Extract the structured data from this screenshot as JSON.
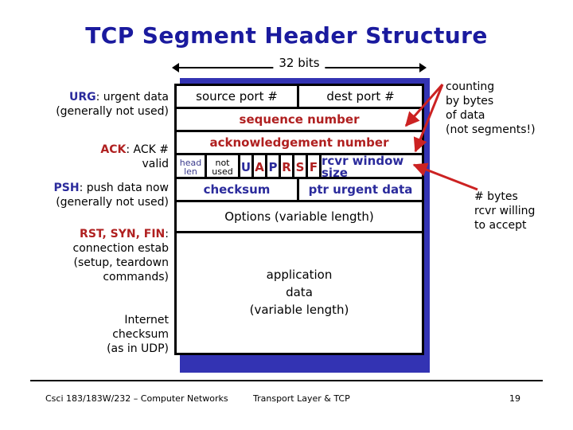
{
  "slide": {
    "title": "TCP Segment Header Structure",
    "page_number": "19"
  },
  "ruler": {
    "label": "32 bits"
  },
  "header_table": {
    "rows": [
      {
        "type": "two-cell",
        "left": "source port #",
        "right": "dest port #"
      },
      {
        "type": "full",
        "text": "sequence number",
        "color": "#b02020"
      },
      {
        "type": "full",
        "text": "acknowledgement number",
        "color": "#b02020"
      },
      {
        "type": "flags"
      },
      {
        "type": "two-cell",
        "left": "checksum",
        "right": "ptr urgent data"
      },
      {
        "type": "full",
        "text": "Options (variable length)",
        "color": "#000000"
      },
      {
        "type": "appdata"
      }
    ],
    "row0": {
      "left": "source port #",
      "right": "dest port #"
    },
    "row1": {
      "text": "sequence number"
    },
    "row2": {
      "text": "acknowledgement number"
    },
    "flags_row": {
      "head_len_line1": "head",
      "head_len_line2": "len",
      "not_used_line1": "not",
      "not_used_line2": "used",
      "bits": [
        {
          "label": "U",
          "color": "#2b2b9c"
        },
        {
          "label": "A",
          "color": "#b02020"
        },
        {
          "label": "P",
          "color": "#2b2b9c"
        },
        {
          "label": "R",
          "color": "#b02020"
        },
        {
          "label": "S",
          "color": "#b02020"
        },
        {
          "label": "F",
          "color": "#b02020"
        }
      ],
      "bit_u": "U",
      "bit_a": "A",
      "bit_p": "P",
      "bit_r": "R",
      "bit_s": "S",
      "bit_f": "F",
      "rcvr_window": "rcvr window size"
    },
    "row4": {
      "left": "checksum",
      "right": "ptr urgent data"
    },
    "row5": {
      "text": "Options (variable length)"
    },
    "app_data": {
      "line1": "application",
      "line2": "data",
      "line3": "(variable length)"
    }
  },
  "left_notes": {
    "urg": {
      "tag": "URG",
      "tag_color": "#2b2b9c",
      "line1": ": urgent data",
      "line2": "(generally not used)"
    },
    "ack": {
      "tag": "ACK",
      "tag_color": "#b02020",
      "line1": ": ACK #",
      "line2": "valid"
    },
    "psh": {
      "tag": "PSH",
      "tag_color": "#2b2b9c",
      "line1": ": push data now",
      "line2": "(generally not used)"
    },
    "rsf": {
      "tag": "RST, SYN, FIN",
      "tag_color": "#b02020",
      "line1": ":",
      "line2": "connection estab",
      "line3": "(setup, teardown",
      "line4": "commands)"
    },
    "internet_checksum": {
      "line1": "Internet",
      "line2": "checksum",
      "line3": "(as in UDP)"
    }
  },
  "right_notes": {
    "counting": {
      "line1": "counting",
      "line2": "by bytes",
      "line3": "of data",
      "line4": "(not segments!)"
    },
    "rcvr": {
      "line1": "# bytes",
      "line2": "rcvr willing",
      "line3": "to accept"
    }
  },
  "footer": {
    "left": "Csci 183/183W/232 – Computer Networks",
    "center": "Transport Layer &  TCP",
    "page": "19"
  },
  "colors": {
    "title_blue": "#1a1a9e",
    "accent_red": "#b02020",
    "accent_blue": "#2b2b9c",
    "shadow_blue": "#3333b3",
    "arrow_red": "#cc2222"
  }
}
